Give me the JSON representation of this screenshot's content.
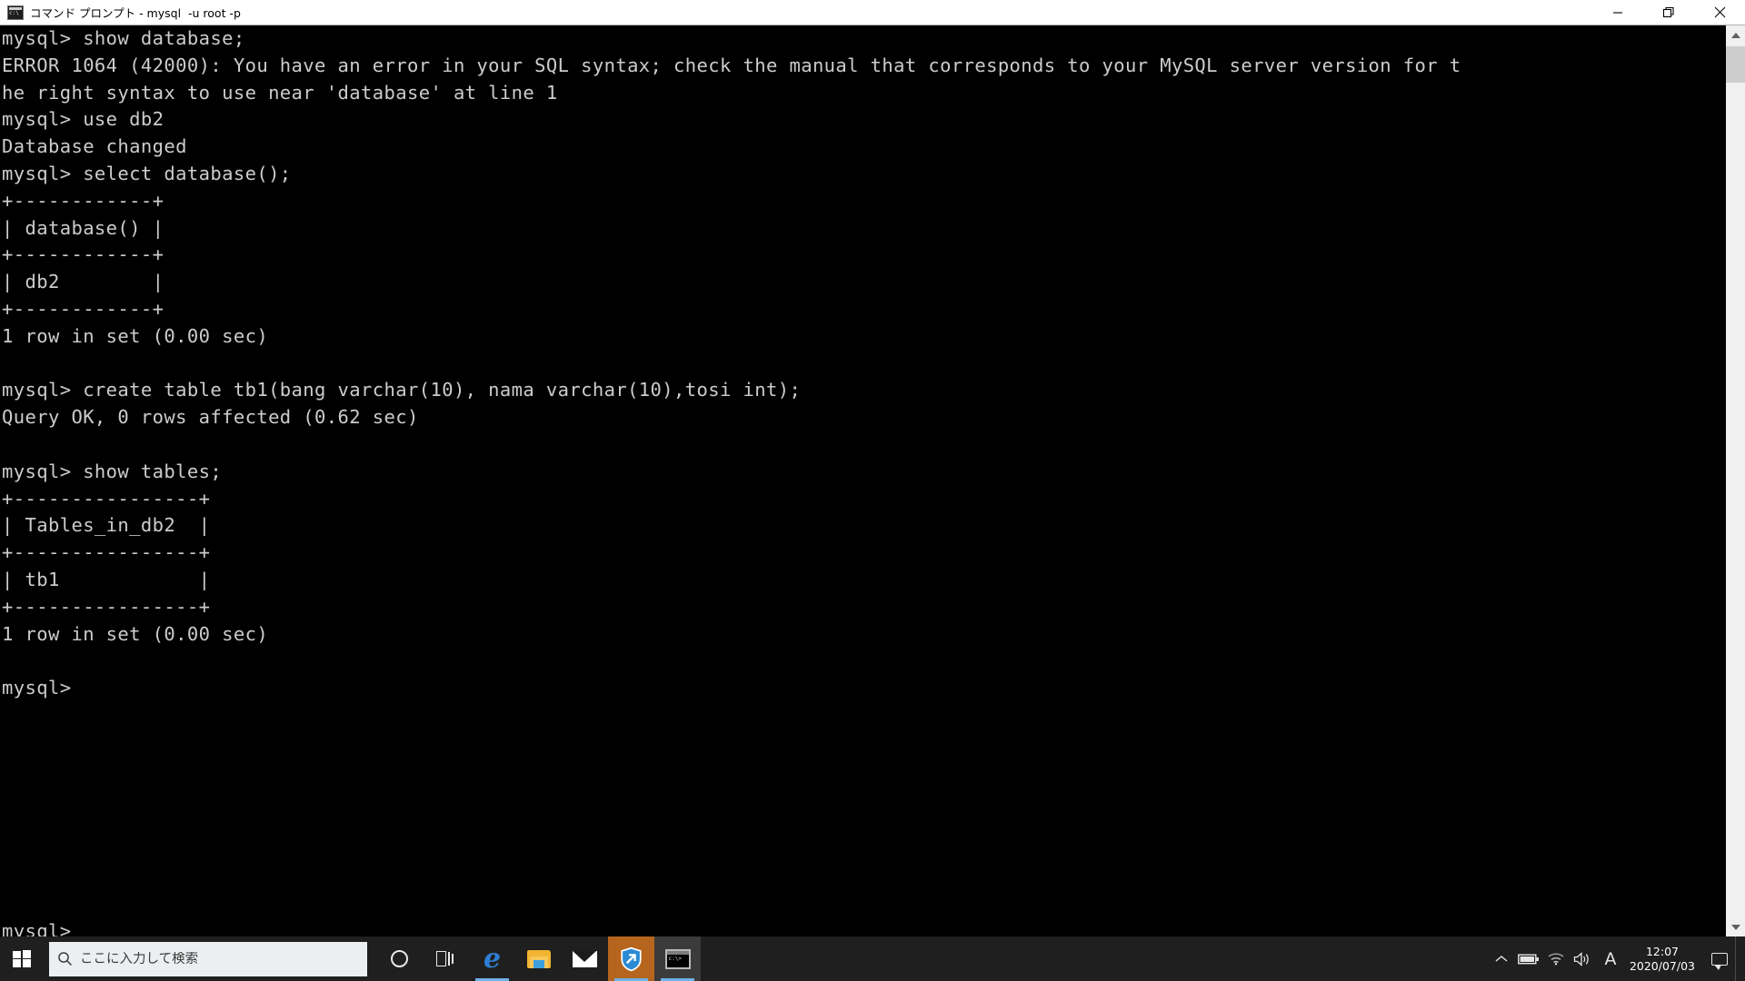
{
  "window": {
    "title": "コマンド プロンプト - mysql  -u root -p",
    "icon": "console-icon",
    "controls": {
      "minimize": "minimize-button",
      "restore": "restore-button",
      "close": "close-button"
    }
  },
  "console": {
    "lines": [
      "mysql> show database;",
      "ERROR 1064 (42000): You have an error in your SQL syntax; check the manual that corresponds to your MySQL server version for t",
      "he right syntax to use near 'database' at line 1",
      "mysql> use db2",
      "Database changed",
      "mysql> select database();",
      "+------------+",
      "| database() |",
      "+------------+",
      "| db2        |",
      "+------------+",
      "1 row in set (0.00 sec)",
      "",
      "mysql> create table tb1(bang varchar(10), nama varchar(10),tosi int);",
      "Query OK, 0 rows affected (0.62 sec)",
      "",
      "mysql> show tables;",
      "+----------------+",
      "| Tables_in_db2  |",
      "+----------------+",
      "| tb1            |",
      "+----------------+",
      "1 row in set (0.00 sec)",
      "",
      "mysql>",
      "",
      "",
      "",
      "",
      "",
      "",
      "",
      "",
      "mysql>"
    ],
    "foreground_color": "#cccccc",
    "background_color": "#000000"
  },
  "taskbar": {
    "start_label": "start-button",
    "search": {
      "placeholder": "ここに入力して検索",
      "value": ""
    },
    "items": [
      {
        "name": "cortana-icon",
        "label": "Cortana",
        "state": "idle"
      },
      {
        "name": "task-view-icon",
        "label": "Task View",
        "state": "idle"
      },
      {
        "name": "edge-icon",
        "label": "Microsoft Edge",
        "state": "running"
      },
      {
        "name": "file-explorer-icon",
        "label": "エクスプローラー",
        "state": "idle"
      },
      {
        "name": "mail-icon",
        "label": "Mail",
        "state": "idle"
      },
      {
        "name": "shield-app-icon",
        "label": "Security App",
        "state": "active"
      },
      {
        "name": "command-prompt-icon",
        "label": "コマンド プロンプト",
        "state": "focused"
      }
    ],
    "tray": {
      "overflow": "show-hidden-icons-icon",
      "battery": "battery-icon",
      "network": "wifi-icon",
      "volume": "speaker-icon",
      "ime": "A",
      "time": "12:07",
      "date": "2020/07/03",
      "action_center": "action-center-icon"
    },
    "accent_color": "#b5651d",
    "background_color": "#1f1f1f"
  },
  "scrollbar": {
    "up_arrow": "scroll-up-arrow",
    "down_arrow": "scroll-down-arrow",
    "thumb": "scroll-thumb"
  }
}
